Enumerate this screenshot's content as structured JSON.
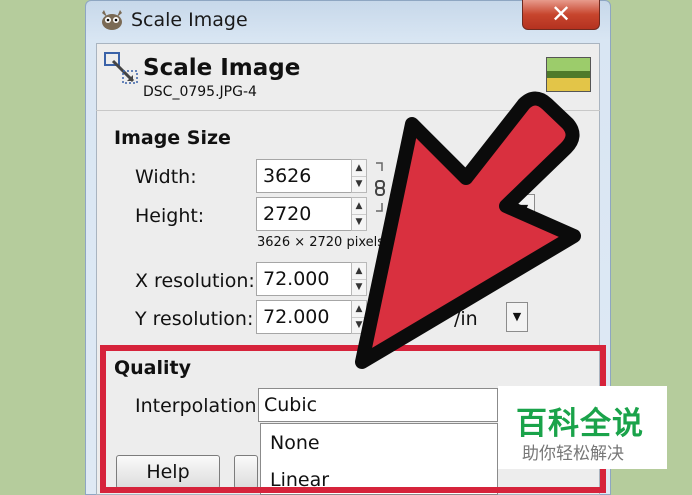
{
  "window": {
    "title": "Scale Image",
    "close_glyph": "✕"
  },
  "header": {
    "title": "Scale Image",
    "subtitle": "DSC_0795.JPG-4"
  },
  "image_size": {
    "title": "Image Size",
    "width_label": "Width:",
    "width_value": "3626",
    "height_label": "Height:",
    "height_value": "2720",
    "dimensions_text": "3626 × 2720 pixels",
    "x_res_label": "X resolution:",
    "x_res_value": "72.000",
    "y_res_label": "Y resolution:",
    "y_res_value": "72.000",
    "res_unit": "/in"
  },
  "quality": {
    "title": "Quality",
    "interpolation_label": "Interpolation:",
    "interpolation_value": "Cubic",
    "options": [
      "None",
      "Linear"
    ]
  },
  "buttons": {
    "help": "Help"
  },
  "watermark": {
    "line1": "百科全说",
    "line2": "助你轻松解决"
  },
  "colors": {
    "highlight": "#d6233b",
    "arrow": "#d9303f",
    "background": "#b5cc9c",
    "close": "#c7452d"
  }
}
